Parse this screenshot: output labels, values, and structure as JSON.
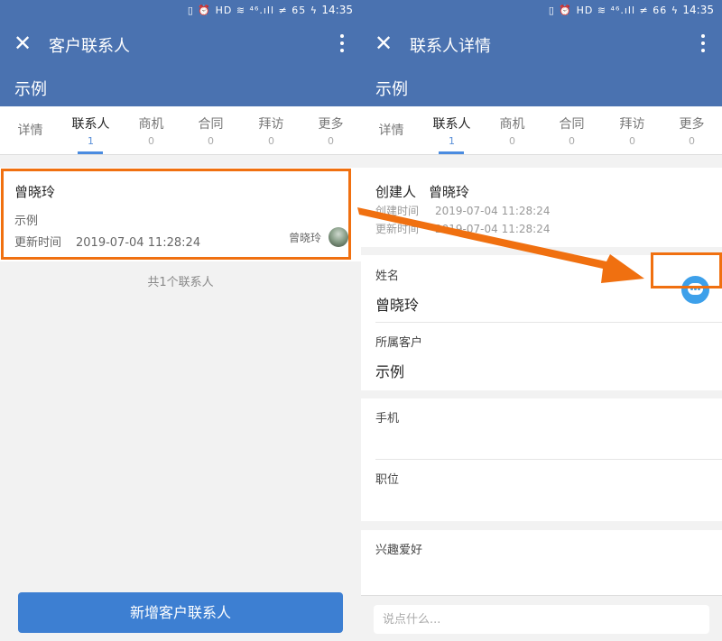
{
  "status_bar": {
    "icons": "▯ ⏰ HD ≋ ⁴⁶.ıll ≠ 65 ϟ",
    "icons_right": "▯ ⏰ HD ≋ ⁴⁶.ıll ≠ 66 ϟ",
    "time": "14:35"
  },
  "left": {
    "title": "客户联系人",
    "customer_name": "示例",
    "tabs": [
      {
        "label": "详情",
        "count": ""
      },
      {
        "label": "联系人",
        "count": "1"
      },
      {
        "label": "商机",
        "count": "0"
      },
      {
        "label": "合同",
        "count": "0"
      },
      {
        "label": "拜访",
        "count": "0"
      },
      {
        "label": "更多",
        "count": "0"
      }
    ],
    "contact": {
      "name": "曾晓玲",
      "customer": "示例",
      "updated_label": "更新时间",
      "updated_value": "2019-07-04 11:28:24",
      "owner": "曾晓玲"
    },
    "summary": "共1个联系人",
    "add_button": "新增客户联系人"
  },
  "right": {
    "title": "联系人详情",
    "customer_name": "示例",
    "tabs": [
      {
        "label": "详情",
        "count": ""
      },
      {
        "label": "联系人",
        "count": "1"
      },
      {
        "label": "商机",
        "count": "0"
      },
      {
        "label": "合同",
        "count": "0"
      },
      {
        "label": "拜访",
        "count": "0"
      },
      {
        "label": "更多",
        "count": "0"
      }
    ],
    "creator_label": "创建人",
    "creator_value": "曾晓玲",
    "created_label": "创建时间",
    "created_value": "2019-07-04 11:28:24",
    "updated_label": "更新时间",
    "updated_value": "2019-07-04 11:28:24",
    "fields": {
      "name_label": "姓名",
      "name_value": "曾晓玲",
      "customer_label": "所属客户",
      "customer_value": "示例",
      "phone_label": "手机",
      "position_label": "职位",
      "hobby_label": "兴趣爱好"
    },
    "comment_placeholder": "说点什么..."
  },
  "colors": {
    "header": "#4a72b0",
    "accent": "#3d7fd2",
    "highlight": "#f07010",
    "fab": "#3da0ea"
  },
  "icons": {
    "close": "close-icon",
    "more": "more-vertical-icon",
    "chat": "chat-bubble-icon",
    "avatar": "avatar"
  }
}
